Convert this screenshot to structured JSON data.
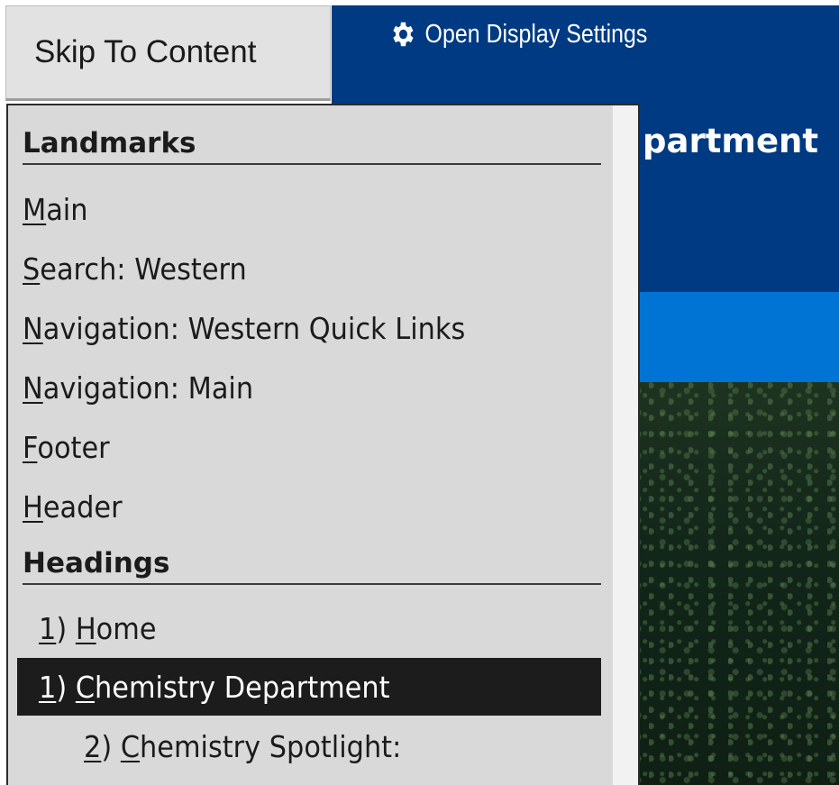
{
  "page": {
    "display_settings_label": "Open Display Settings",
    "title_fragment": "partment",
    "colors": {
      "header_bg": "#003a82",
      "nav_bar": "#0074d4",
      "menu_bg": "#d9d9d9",
      "selected_bg": "#1c1c1c"
    }
  },
  "skip": {
    "label": "Skip To Content"
  },
  "menu": {
    "landmarks_title": "Landmarks",
    "landmarks": [
      {
        "key": "M",
        "rest": "ain"
      },
      {
        "key": "S",
        "rest": "earch: Western"
      },
      {
        "key": "N",
        "rest": "avigation: Western Quick Links"
      },
      {
        "key": "N",
        "rest": "avigation: Main"
      },
      {
        "key": "F",
        "rest": "ooter"
      },
      {
        "key": "H",
        "rest": "eader"
      }
    ],
    "headings_title": "Headings",
    "headings": [
      {
        "num": "1",
        "suffix": ") ",
        "key": "H",
        "rest": "ome"
      },
      {
        "num": "1",
        "suffix": ") ",
        "key": "C",
        "rest": "hemistry Department"
      },
      {
        "num": "2",
        "suffix": ") ",
        "key": "C",
        "rest": "hemistry Spotlight:"
      }
    ]
  }
}
